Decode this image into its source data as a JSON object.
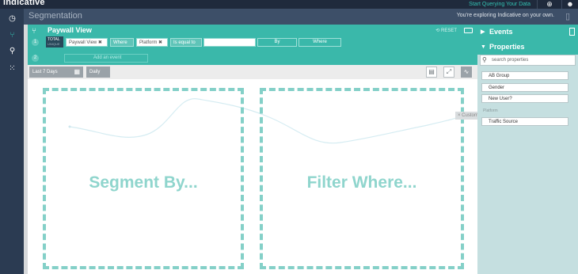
{
  "app": {
    "brand": "indicative",
    "start_link": "Start Querying Your Data"
  },
  "header": {
    "title": "Segmentation",
    "explore_note": "You're exploring Indicative on your own."
  },
  "query": {
    "title": "Paywall View",
    "reset_label": "RESET",
    "row1_num": "1",
    "row2_num": "2",
    "total_label": "TOTAL",
    "total_sub": "UNIQUE",
    "event_chip": "Paywall View ✖",
    "where_chip": "Where",
    "property_chip": "Platform ✖",
    "operator_chip": "Is equal to",
    "by_button": "By",
    "where_button": "Where",
    "add_event_placeholder": "Add an event"
  },
  "toolbar": {
    "date_range": "Last 7 Days",
    "interval": "Daily"
  },
  "chart": {
    "segment_label": "Segment By...",
    "filter_label": "Filter Where...",
    "drag_tag": "× Custom..."
  },
  "right_panel": {
    "events_label": "Events",
    "properties_label": "Properties",
    "search_placeholder": "search properties",
    "properties": [
      "AB Group",
      "Gender",
      "New User?"
    ],
    "group_label": "Platform",
    "extra_property": "Traffic Source"
  },
  "colors": {
    "accent": "#3ab8aa",
    "dropzone": "#84d0c8",
    "nav": "#2b3b52"
  }
}
